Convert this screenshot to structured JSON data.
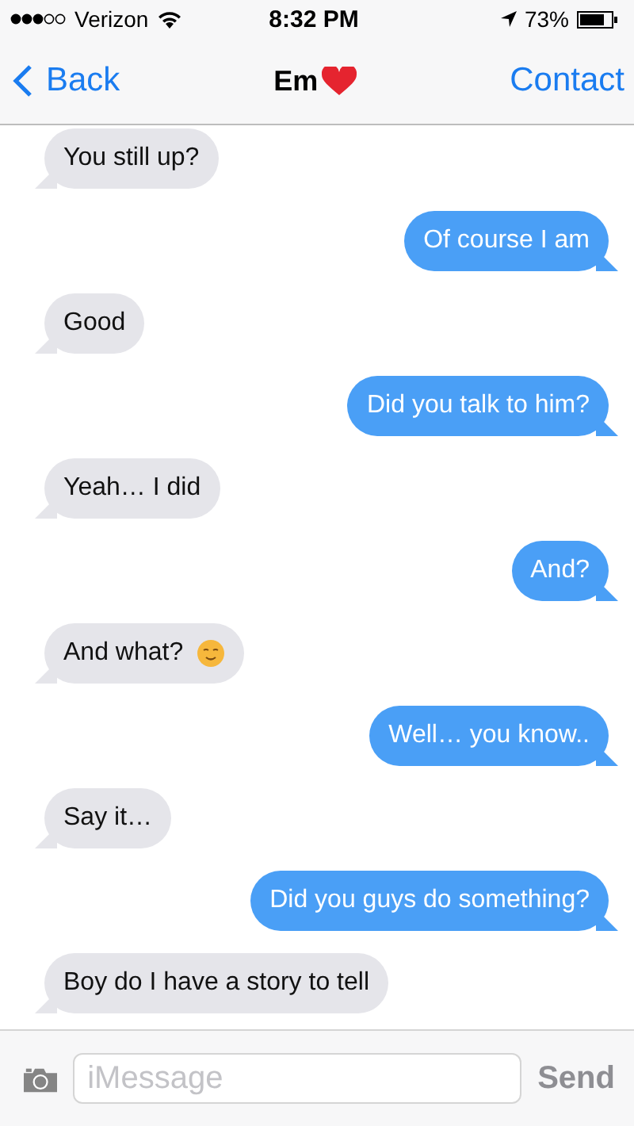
{
  "status_bar": {
    "carrier": "Verizon",
    "time": "8:32 PM",
    "battery": "73%"
  },
  "nav": {
    "back": "Back",
    "title": "Em",
    "contact": "Contact"
  },
  "messages": [
    {
      "kind": "received",
      "text": "You still up?",
      "emoji": false
    },
    {
      "kind": "sent",
      "text": "Of course I am",
      "emoji": false
    },
    {
      "kind": "received",
      "text": "Good",
      "emoji": false
    },
    {
      "kind": "sent",
      "text": "Did you talk to him?",
      "emoji": false
    },
    {
      "kind": "received",
      "text": "Yeah… I did",
      "emoji": false
    },
    {
      "kind": "sent",
      "text": "And?",
      "emoji": false
    },
    {
      "kind": "received",
      "text": "And what?",
      "emoji": true
    },
    {
      "kind": "sent",
      "text": "Well… you know..",
      "emoji": false
    },
    {
      "kind": "received",
      "text": "Say it…",
      "emoji": false
    },
    {
      "kind": "sent",
      "text": "Did you guys do something?",
      "emoji": false
    },
    {
      "kind": "received",
      "text": "Boy do I have a story to tell",
      "emoji": false
    }
  ],
  "compose": {
    "placeholder": "iMessage",
    "send": "Send"
  }
}
